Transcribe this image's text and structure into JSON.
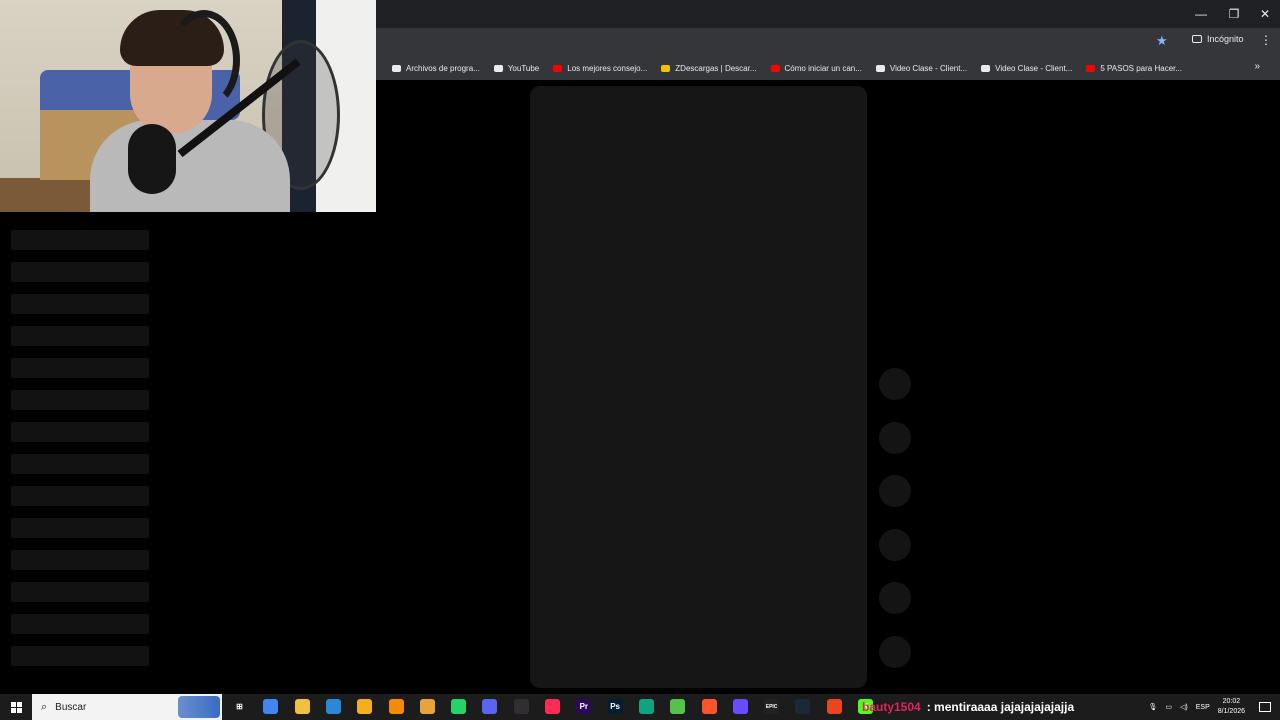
{
  "window": {
    "controls": {
      "minimize": "—",
      "restore": "❐",
      "close": "✕"
    }
  },
  "toolbar": {
    "star_icon": "star-icon",
    "incognito_label": "Incógnito",
    "menu_icon": "⋮"
  },
  "bookmarks": [
    {
      "label": "Archivos de progra...",
      "icon": "folder-icon",
      "color": "#e8eaed"
    },
    {
      "label": "YouTube",
      "icon": "folder-icon",
      "color": "#e8eaed"
    },
    {
      "label": "Los mejores consejo...",
      "icon": "youtube-icon",
      "color": "#ff0000"
    },
    {
      "label": "ZDescargas | Descar...",
      "icon": "zdescargas-icon",
      "color": "#f2c200"
    },
    {
      "label": "Cómo iniciar un can...",
      "icon": "youtube-icon",
      "color": "#ff0000"
    },
    {
      "label": "Video Clase - Client...",
      "icon": "cc-icon",
      "color": "#e8eaed"
    },
    {
      "label": "Video Clase - Client...",
      "icon": "cc-icon",
      "color": "#e8eaed"
    },
    {
      "label": "5 PASOS para Hacer...",
      "icon": "youtube-icon",
      "color": "#ff0000"
    }
  ],
  "bookmarks_more": "»",
  "taskbar": {
    "search_placeholder": "Buscar",
    "chat_user": "bauty1504",
    "chat_message": ": mentiraaaa jajajajajajajja",
    "language": "ESP",
    "time": "20:02",
    "date": "8/1/2026"
  },
  "colors": {
    "background": "#000000",
    "panel": "#161616",
    "skeleton": "#121212",
    "accent": "#8ab4f8"
  }
}
